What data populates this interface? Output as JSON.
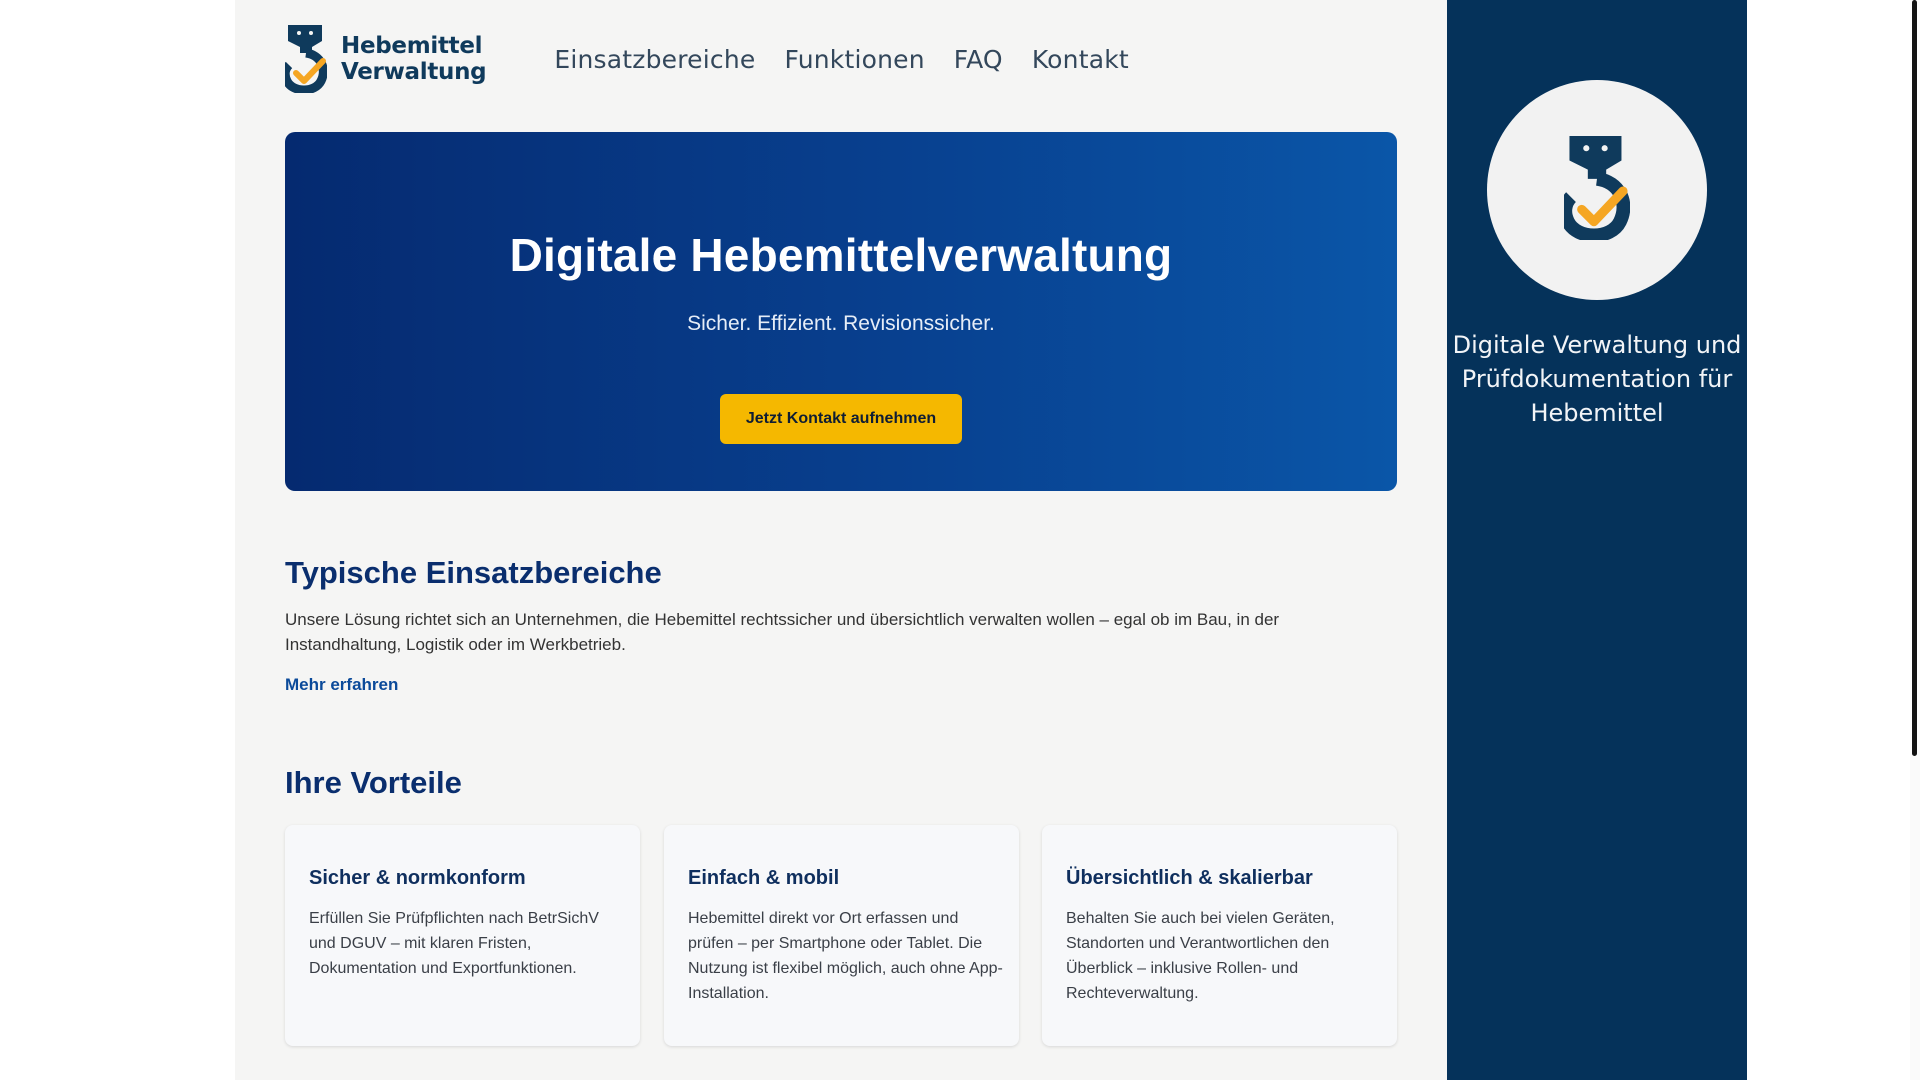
{
  "brand": {
    "logo_line1": "Hebemittel",
    "logo_line2": "Verwaltung",
    "icon": "crane-hook-check-icon",
    "colors": {
      "navy": "#0f3a5c",
      "accent": "#f5a623"
    }
  },
  "nav": {
    "items": [
      {
        "label": "Einsatzbereiche"
      },
      {
        "label": "Funktionen"
      },
      {
        "label": "FAQ"
      },
      {
        "label": "Kontakt"
      }
    ]
  },
  "hero": {
    "title": "Digitale Hebemittelverwaltung",
    "subtitle": "Sicher. Effizient. Revisionssicher.",
    "cta_label": "Jetzt Kontakt aufnehmen",
    "colors": {
      "gradient_start": "#052a70",
      "gradient_end": "#0a56a8",
      "cta": "#f5b800"
    }
  },
  "einsatz": {
    "title": "Typische Einsatzbereiche",
    "text": "Unsere Lösung richtet sich an Unternehmen, die Hebemittel rechtssicher und übersichtlich verwalten wollen – egal ob im Bau, in der Instandhaltung, Logistik oder im Werkbetrieb.",
    "link": "Mehr erfahren"
  },
  "vorteile": {
    "title": "Ihre Vorteile",
    "cards": [
      {
        "title": "Sicher & normkonform",
        "text": "Erfüllen Sie Prüfpflichten nach BetrSichV und DGUV – mit klaren Fristen, Dokumentation und Exportfunktionen."
      },
      {
        "title": "Einfach & mobil",
        "text": "Hebemittel direkt vor Ort erfassen und prüfen – per Smartphone oder Tablet. Die Nutzung ist flexibel möglich, auch ohne App-Installation."
      },
      {
        "title": "Übersichtlich & skalierbar",
        "text": "Behalten Sie auch bei vielen Geräten, Standorten und Verantwortlichen den Überblick – inklusive Rollen- und Rechteverwaltung."
      }
    ]
  },
  "sidebar": {
    "icon": "crane-hook-check-icon",
    "text": "Digitale Verwaltung und Prüfdokumentation für Hebemittel",
    "colors": {
      "background": "#05325a"
    }
  }
}
